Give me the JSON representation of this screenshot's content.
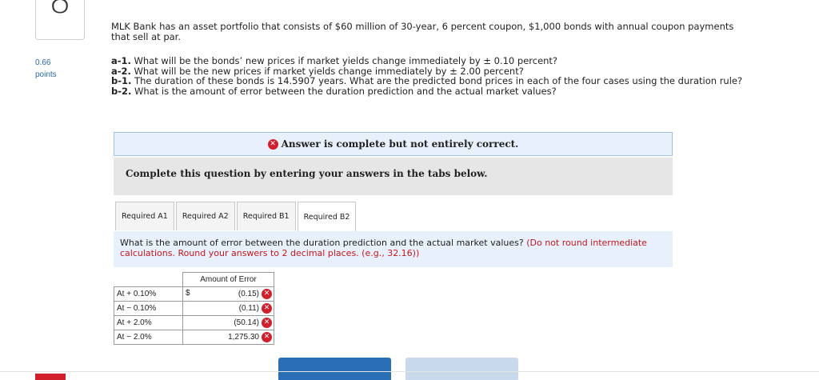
{
  "question": {
    "number": "8",
    "points_value": "0.66",
    "points_label": "points",
    "text": "MLK Bank has an asset portfolio that consists of $60 million of 30-year, 6 percent coupon, $1,000 bonds with annual coupon payments that sell at par.",
    "parts": [
      {
        "label": "a-1.",
        "text": " What will be the bonds’ new prices if market yields change immediately by ± 0.10 percent?"
      },
      {
        "label": "a-2.",
        "text": " What will be the new prices if market yields change immediately by ± 2.00 percent?"
      },
      {
        "label": "b-1.",
        "text": " The duration of these bonds is 14.5907 years. What are the predicted bond prices in each of the four cases using the duration rule?"
      },
      {
        "label": "b-2.",
        "text": " What is the amount of error between the duration prediction and the actual market values?"
      }
    ]
  },
  "banner": {
    "icon": "x-circle-icon",
    "text": "Answer is complete but not entirely correct."
  },
  "instruction": "Complete this question by entering your answers in the tabs below.",
  "tabs": [
    {
      "label": "Required A1",
      "active": false
    },
    {
      "label": "Required A2",
      "active": false
    },
    {
      "label": "Required B1",
      "active": false
    },
    {
      "label": "Required B2",
      "active": true
    }
  ],
  "prompt": {
    "text": "What is the amount of error between the duration prediction and the actual market values? ",
    "hint": "(Do not round intermediate calculations. Round your answers to 2 decimal places. (e.g., 32.16))"
  },
  "table": {
    "header": "Amount of Error",
    "currency": "$",
    "rows": [
      {
        "label": "At + 0.10%",
        "value": "(0.15)",
        "status": "incorrect"
      },
      {
        "label": "At − 0.10%",
        "value": "(0.11)",
        "status": "incorrect"
      },
      {
        "label": "At + 2.0%",
        "value": "(50.14)",
        "status": "incorrect"
      },
      {
        "label": "At − 2.0%",
        "value": "1,275.30",
        "status": "incorrect"
      }
    ]
  },
  "colors": {
    "accent": "#2a6fb5",
    "error": "#d11f2c",
    "info_bg": "#e8f1fb"
  }
}
